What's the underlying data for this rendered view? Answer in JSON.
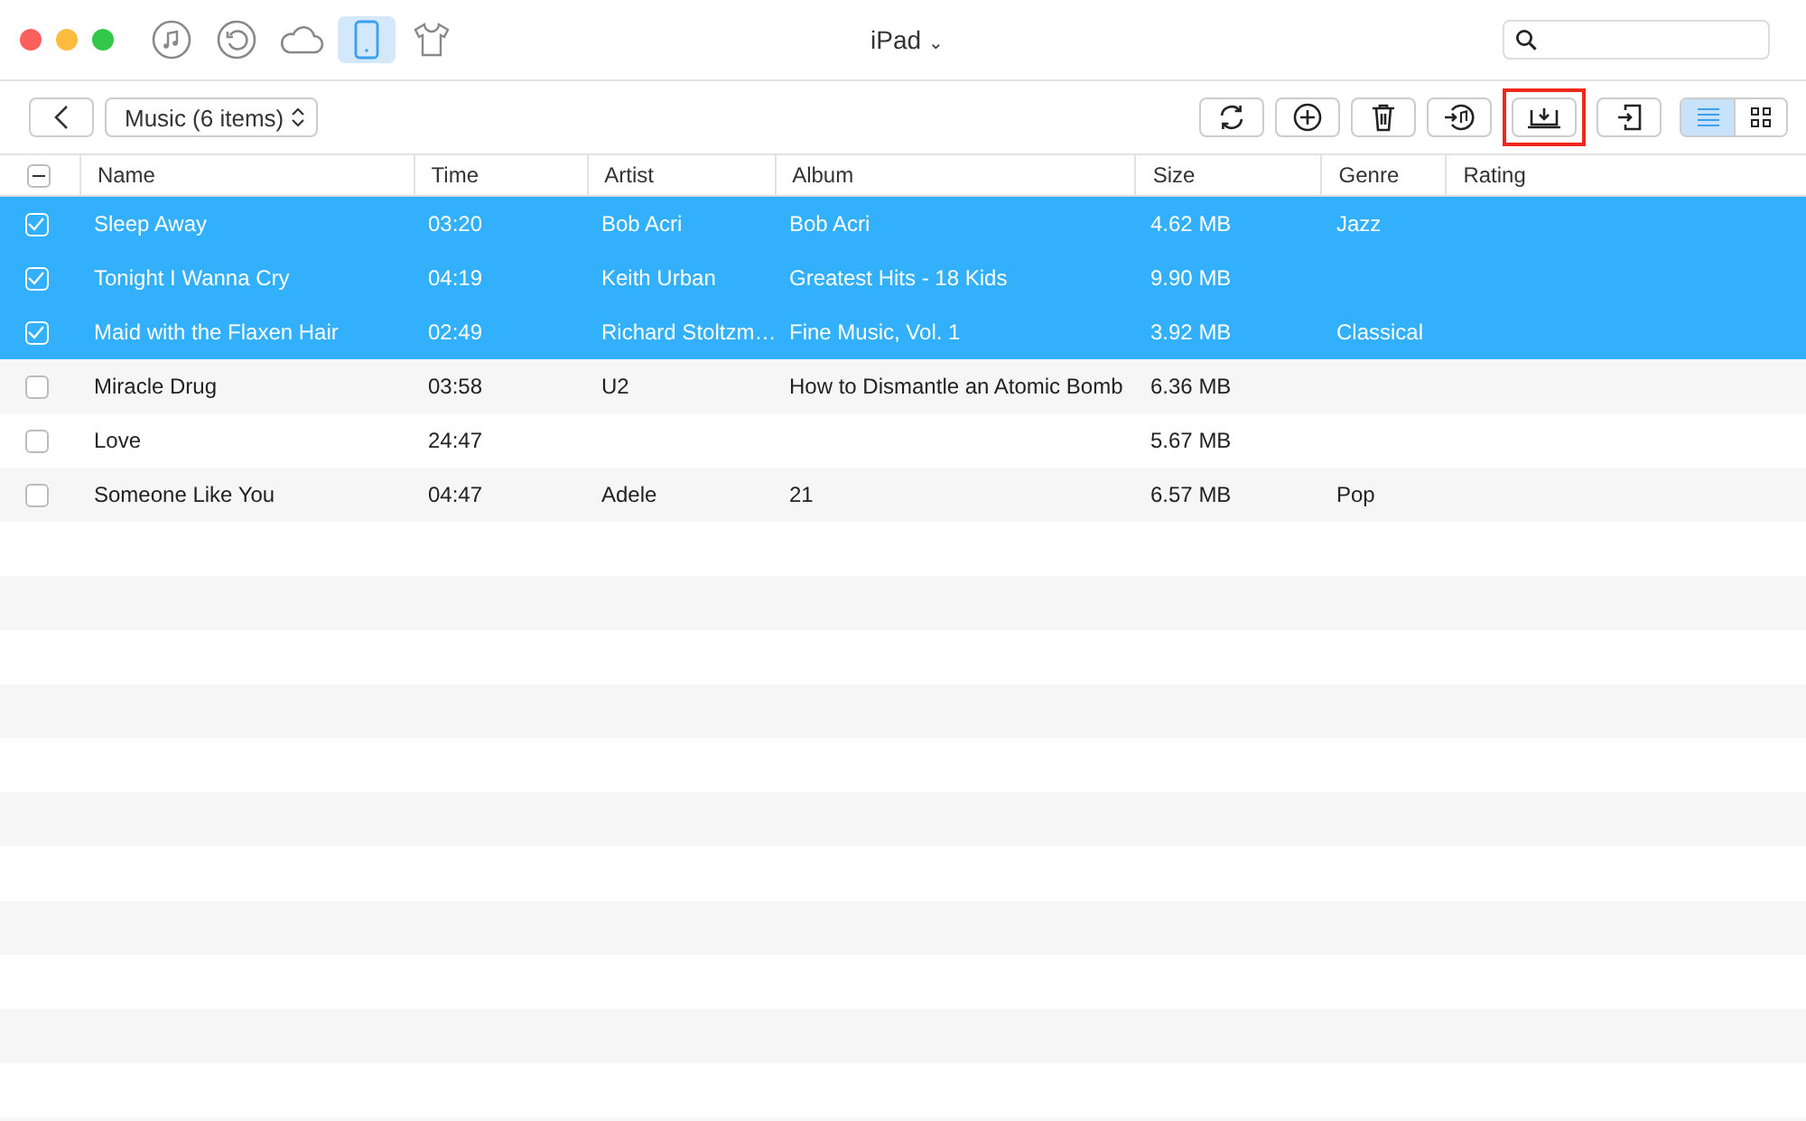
{
  "window": {
    "title": "iPad",
    "title_caret": "⌄"
  },
  "nav_icons": [
    {
      "kind": "music",
      "selected": false
    },
    {
      "kind": "restore",
      "selected": false
    },
    {
      "kind": "cloud",
      "selected": false
    },
    {
      "kind": "device",
      "selected": true
    },
    {
      "kind": "shirt",
      "selected": false
    }
  ],
  "category": {
    "label": "Music (6 items)"
  },
  "actions": [
    {
      "kind": "refresh",
      "highlighted": false
    },
    {
      "kind": "add",
      "highlighted": false
    },
    {
      "kind": "delete",
      "highlighted": false
    },
    {
      "kind": "to-itunes",
      "highlighted": false
    },
    {
      "kind": "to-computer",
      "highlighted": true
    },
    {
      "kind": "to-device",
      "highlighted": false
    }
  ],
  "views": [
    {
      "kind": "list",
      "selected": true
    },
    {
      "kind": "grid",
      "selected": false
    }
  ],
  "table": {
    "all_indeterminate": true,
    "columns": [
      "Name",
      "Time",
      "Artist",
      "Album",
      "Size",
      "Genre",
      "Rating"
    ],
    "rows": [
      {
        "selected": true,
        "cells": [
          "Sleep Away",
          "03:20",
          "Bob Acri",
          "Bob Acri",
          "4.62 MB",
          "Jazz",
          ""
        ]
      },
      {
        "selected": true,
        "cells": [
          "Tonight I Wanna Cry",
          "04:19",
          "Keith Urban",
          "Greatest Hits - 18 Kids",
          "9.90 MB",
          "",
          ""
        ]
      },
      {
        "selected": true,
        "cells": [
          "Maid with the Flaxen Hair",
          "02:49",
          "Richard Stoltzm…",
          "Fine Music, Vol. 1",
          "3.92 MB",
          "Classical",
          ""
        ]
      },
      {
        "selected": false,
        "cells": [
          "Miracle Drug",
          "03:58",
          "U2",
          "How to Dismantle an Atomic Bomb",
          "6.36 MB",
          "",
          ""
        ]
      },
      {
        "selected": false,
        "cells": [
          "Love",
          "24:47",
          "",
          "",
          "5.67 MB",
          "",
          ""
        ]
      },
      {
        "selected": false,
        "cells": [
          "Someone Like You",
          "04:47",
          "Adele",
          "21",
          "6.57 MB",
          "Pop",
          ""
        ]
      }
    ]
  }
}
